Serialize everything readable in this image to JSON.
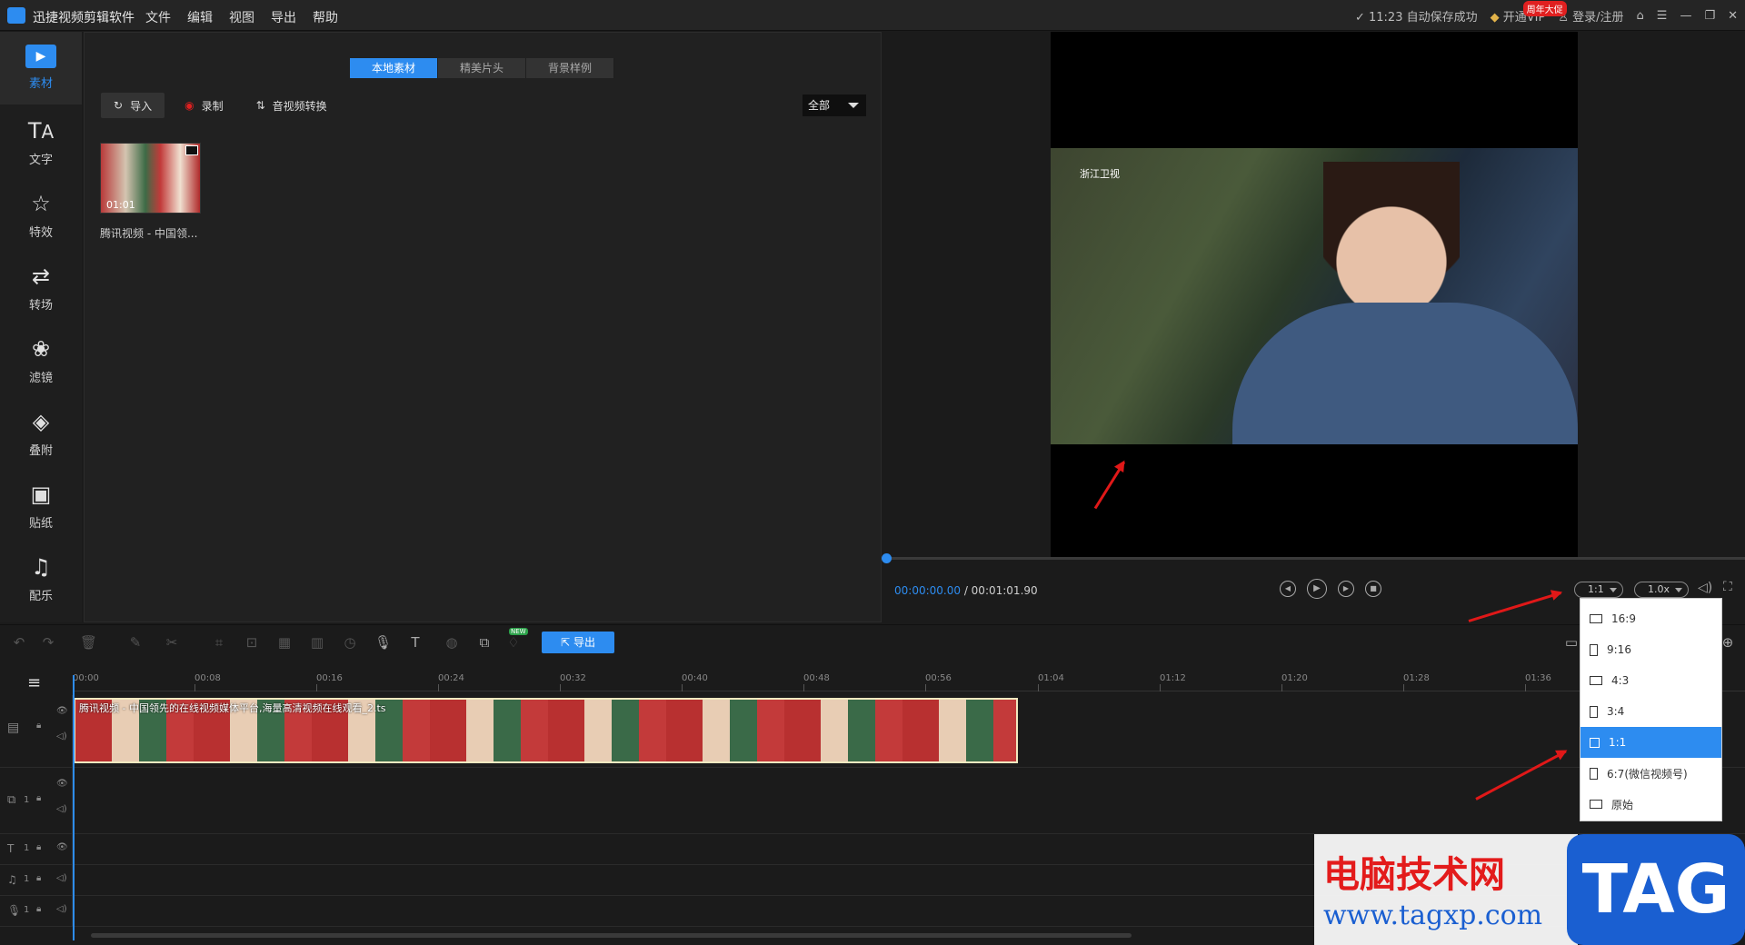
{
  "app": {
    "title": "迅捷视频剪辑软件",
    "menu": [
      "文件",
      "编辑",
      "视图",
      "导出",
      "帮助"
    ],
    "autosave": "11:23 自动保存成功",
    "vip_label": "开通VIP",
    "vip_badge": "周年大促",
    "login": "登录/注册"
  },
  "sidebar": {
    "items": [
      {
        "label": "素材",
        "icon": "media-icon"
      },
      {
        "label": "文字",
        "icon": "text-icon"
      },
      {
        "label": "特效",
        "icon": "effects-icon"
      },
      {
        "label": "转场",
        "icon": "transition-icon"
      },
      {
        "label": "滤镜",
        "icon": "filter-icon"
      },
      {
        "label": "叠附",
        "icon": "overlay-icon"
      },
      {
        "label": "贴纸",
        "icon": "sticker-icon"
      },
      {
        "label": "配乐",
        "icon": "music-icon"
      }
    ]
  },
  "media": {
    "tabs": [
      "本地素材",
      "精美片头",
      "背景样例"
    ],
    "import_label": "导入",
    "record_label": "录制",
    "convert_label": "音视频转换",
    "filter_value": "全部",
    "item": {
      "name": "腾讯视频 - 中国领...",
      "duration": "01:01"
    }
  },
  "preview": {
    "current_time": "00:00:00.00",
    "total_time": "/ 00:01:01.90",
    "ratio_value": "1:1",
    "speed_value": "1.0x",
    "channel_logo": "浙江卫视"
  },
  "ratio_menu": {
    "options": [
      "16:9",
      "9:16",
      "4:3",
      "3:4",
      "1:1",
      "6:7(微信视频号)",
      "原始"
    ],
    "selected": "1:1"
  },
  "timeline": {
    "export_label": "导出",
    "new_badge": "NEW",
    "ruler": [
      "00:00",
      "00:08",
      "00:16",
      "00:24",
      "00:32",
      "00:40",
      "00:48",
      "00:56",
      "01:04",
      "01:12",
      "01:20",
      "01:28",
      "01:36"
    ],
    "clip_name": "腾讯视频 - 中国领先的在线视频媒体平台,海量高清视频在线观看_2.ts",
    "track_numbers": [
      "1",
      "1",
      "1",
      "1"
    ]
  },
  "watermark": {
    "title": "电脑技术网",
    "url": "www.tagxp.com",
    "tag": "TAG"
  },
  "colors": {
    "accent": "#2d8cf0",
    "annotation_arrow": "#e01818"
  }
}
